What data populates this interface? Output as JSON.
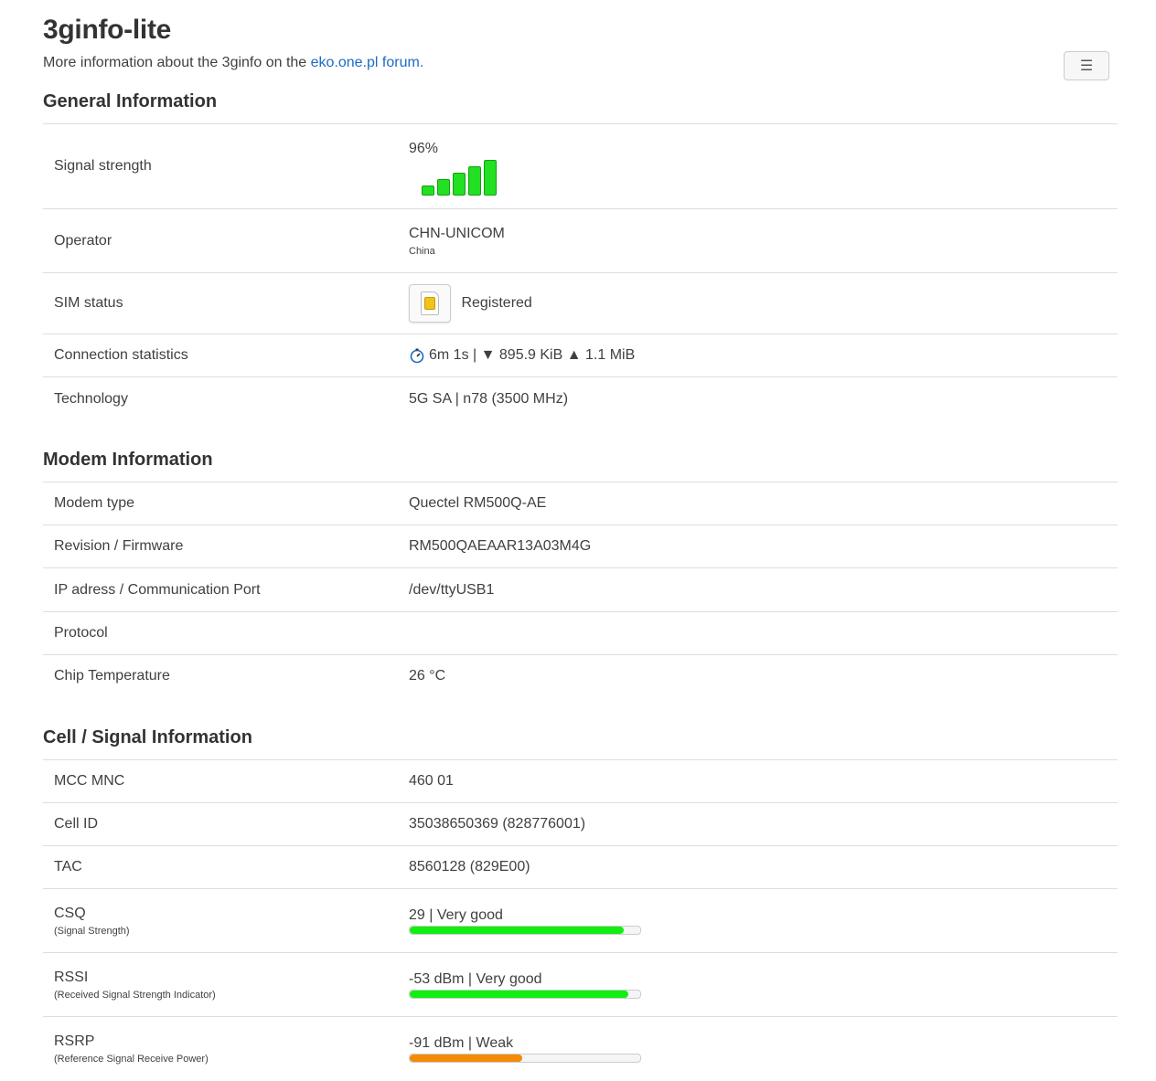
{
  "header": {
    "title": "3ginfo-lite",
    "subtitle_prefix": "More information about the 3ginfo on the ",
    "subtitle_link": "eko.one.pl forum.",
    "menu_icon": "☰"
  },
  "sections": {
    "general": {
      "title": "General Information",
      "signal_label": "Signal strength",
      "signal_value": "96%",
      "signal_bars": 5,
      "operator_label": "Operator",
      "operator_value": "CHN-UNICOM",
      "operator_country": "China",
      "sim_label": "SIM status",
      "sim_value": "Registered",
      "conn_label": "Connection statistics",
      "conn_value": "6m 1s | ▼ 895.9 KiB ▲ 1.1 MiB",
      "tech_label": "Technology",
      "tech_value": "5G SA | n78 (3500 MHz)"
    },
    "modem": {
      "title": "Modem Information",
      "rows": [
        {
          "label": "Modem type",
          "value": "Quectel RM500Q-AE"
        },
        {
          "label": "Revision / Firmware",
          "value": "RM500QAEAAR13A03M4G"
        },
        {
          "label": "IP adress / Communication Port",
          "value": "/dev/ttyUSB1"
        },
        {
          "label": "Protocol",
          "value": ""
        },
        {
          "label": "Chip Temperature",
          "value": "26 °C"
        }
      ]
    },
    "cell": {
      "title": "Cell / Signal Information",
      "rows": [
        {
          "label": "MCC MNC",
          "value": "460 01"
        },
        {
          "label": "Cell ID",
          "value": "35038650369 (828776001)"
        },
        {
          "label": "TAC",
          "value": "8560128 (829E00)"
        }
      ],
      "meters": [
        {
          "label": "CSQ",
          "sublabel": "(Signal Strength)",
          "value": "29 | Very good",
          "level": 0.93,
          "color": "#11ee11"
        },
        {
          "label": "RSSI",
          "sublabel": "(Received Signal Strength Indicator)",
          "value": "-53 dBm | Very good",
          "level": 0.95,
          "color": "#11ee11"
        },
        {
          "label": "RSRP",
          "sublabel": "(Reference Signal Receive Power)",
          "value": "-91 dBm | Weak",
          "level": 0.49,
          "color": "#f58a07"
        }
      ]
    }
  }
}
